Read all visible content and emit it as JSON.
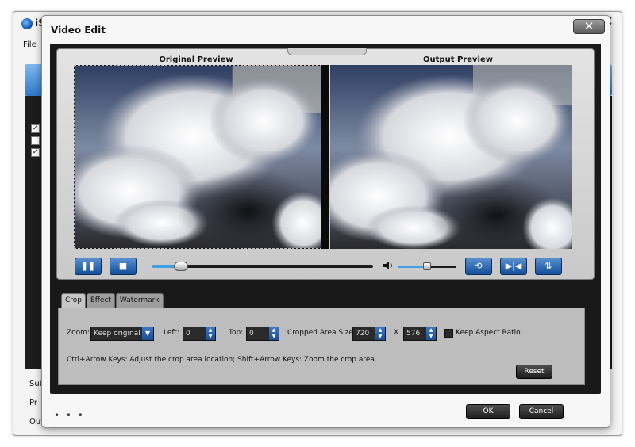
{
  "app": {
    "title_partial": "iS",
    "menu_file": "File"
  },
  "background": {
    "lower_labels": [
      "Sub",
      "Pr",
      "Out"
    ]
  },
  "dialog": {
    "title": "Video Edit",
    "close_glyph": "✕",
    "original_preview_label": "Original Preview",
    "output_preview_label": "Output Preview",
    "playback": {
      "progress": 0.13,
      "volume": 0.5
    },
    "tabs": [
      {
        "label": "Crop",
        "active": true
      },
      {
        "label": "Effect",
        "active": false
      },
      {
        "label": "Watermark",
        "active": false
      }
    ],
    "crop": {
      "zoom_label": "Zoom:",
      "zoom_value": "Keep original",
      "left_label": "Left:",
      "left_value": "0",
      "top_label": "Top:",
      "top_value": "0",
      "cropped_area_label": "Cropped Area Size:",
      "width_value": "720",
      "x_label": "X",
      "height_value": "576",
      "keep_aspect_label": "Keep Aspect Ratio",
      "keep_aspect_checked": false,
      "hint": "Ctrl+Arrow Keys: Adjust the crop area location; Shift+Arrow Keys: Zoom the crop area.",
      "reset_label": "Reset"
    },
    "ellipsis": "• • •",
    "ok_label": "OK",
    "cancel_label": "Cancel"
  },
  "colors": {
    "accent_blue": "#1c4f93",
    "progress_blue": "#3fa0e6",
    "panel_dark": "#191919"
  },
  "icons": [
    "pause-icon",
    "stop-icon",
    "volume-icon",
    "rotate-icon",
    "flip-horizontal-icon",
    "flip-vertical-icon",
    "close-icon",
    "chevron-down-icon"
  ]
}
